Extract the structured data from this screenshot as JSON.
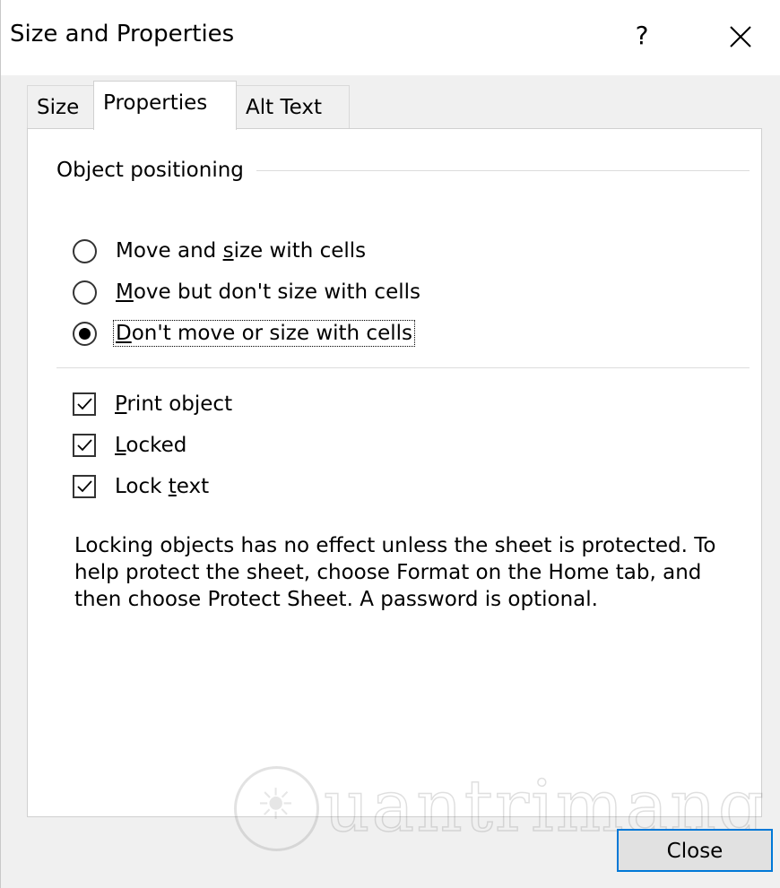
{
  "window": {
    "title": "Size and Properties",
    "help_label": "?"
  },
  "tabs": [
    {
      "label": "Size",
      "active": false
    },
    {
      "label": "Properties",
      "active": true
    },
    {
      "label": "Alt Text",
      "active": false
    }
  ],
  "object_positioning": {
    "heading": "Object positioning",
    "options": [
      {
        "pre": "Move and ",
        "key": "s",
        "post": "ize with cells",
        "checked": false
      },
      {
        "pre": "",
        "key": "M",
        "post": "ove but don't size with cells",
        "checked": false
      },
      {
        "pre": "",
        "key": "D",
        "post": "on't move or size with cells",
        "checked": true
      }
    ]
  },
  "checkboxes": [
    {
      "pre": "",
      "key": "P",
      "post": "rint object",
      "checked": true
    },
    {
      "pre": "",
      "key": "L",
      "post": "ocked",
      "checked": true
    },
    {
      "pre": "Lock ",
      "key": "t",
      "post": "ext",
      "checked": true
    }
  ],
  "info_lines": [
    "Locking objects has no effect unless the sheet is protected. To",
    "help protect the sheet, choose Format on the Home tab, and",
    "then choose Protect Sheet. A password is optional."
  ],
  "watermark": {
    "text": "uantrimang"
  },
  "buttons": {
    "close": "Close"
  },
  "icons": {
    "close": "close-icon",
    "radio_selected": "radio-dot",
    "checkbox": "checkmark-icon"
  }
}
